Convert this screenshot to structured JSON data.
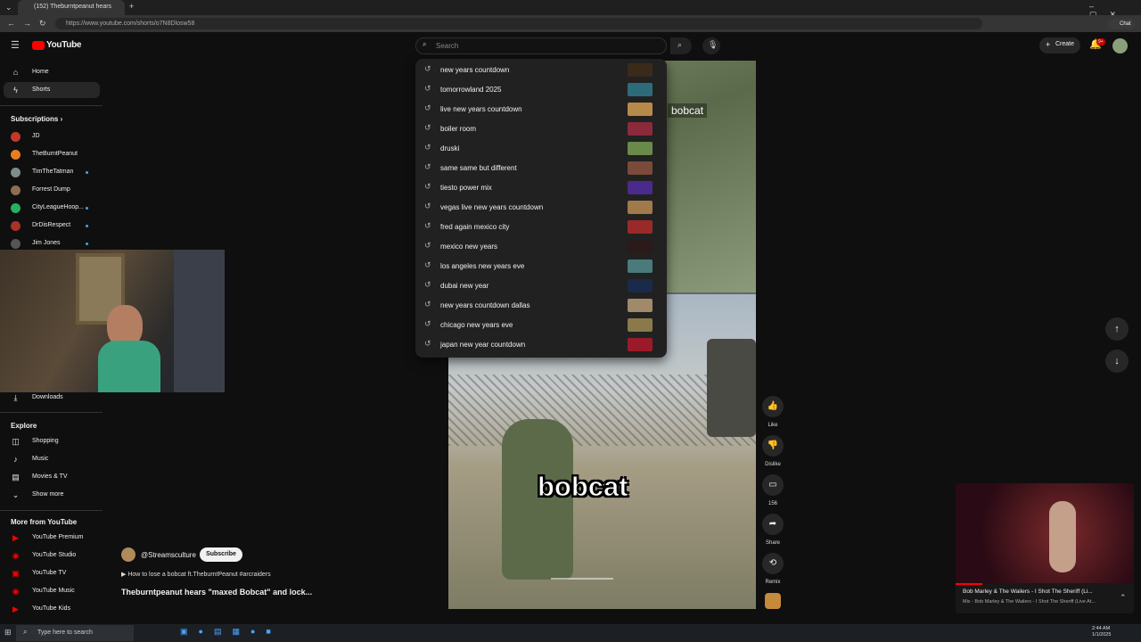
{
  "browser": {
    "tab_title": "(152) Theburntpeanut hears",
    "url": "https://www.youtube.com/shorts/o7N8Dlosw58",
    "chat_label": "Chat"
  },
  "youtube": {
    "logo_text": "YouTube",
    "search_placeholder": "Search",
    "create_label": "Create",
    "notif_count": "9+"
  },
  "sidebar": {
    "home": "Home",
    "shorts": "Shorts",
    "subscriptions_header": "Subscriptions",
    "subscriptions": [
      "JD",
      "TheBurntPeanut",
      "TimTheTatman",
      "Forrest Dump",
      "CityLeagueHoop...",
      "DrDisRespect",
      "Jim Jones"
    ],
    "downloads": "Downloads",
    "explore_header": "Explore",
    "explore": [
      "Shopping",
      "Music",
      "Movies & TV",
      "Show more"
    ],
    "more_header": "More from YouTube",
    "more": [
      "YouTube Premium",
      "YouTube Studio",
      "YouTube TV",
      "YouTube Music",
      "YouTube Kids"
    ]
  },
  "suggestions": [
    "new years countdown",
    "tomorrowland 2025",
    "live new years countdown",
    "boiler room",
    "druski",
    "same same but different",
    "tiesto power mix",
    "vegas live new years countdown",
    "fred again mexico city",
    "mexico new years",
    "los angeles new years eve",
    "dubai new year",
    "new years countdown dallas",
    "chicago new years eve",
    "japan new year countdown"
  ],
  "video": {
    "caption_top": "bobcat",
    "caption_main": "bobcat",
    "channel": "@Streamsculture",
    "subscribe": "Subscribe",
    "music_line": "How to lose a bobcat  ft.TheburntPeanut  #arcraiders",
    "title": "Theburntpeanut hears \"maxed Bobcat\" and lock..."
  },
  "actions": {
    "like": "Like",
    "dislike": "Dislike",
    "comments": "156",
    "share": "Share",
    "remix": "Remix"
  },
  "miniplayer": {
    "title": "Bob Marley & The Wailers - I Shot The Sheriff (Li...",
    "subtitle": "Mix - Bob Marley & The Wailers - I Shot The Sheriff (Live At..."
  },
  "taskbar": {
    "search_placeholder": "Type here to search",
    "time": "2:44 AM",
    "date": "1/1/2025"
  }
}
